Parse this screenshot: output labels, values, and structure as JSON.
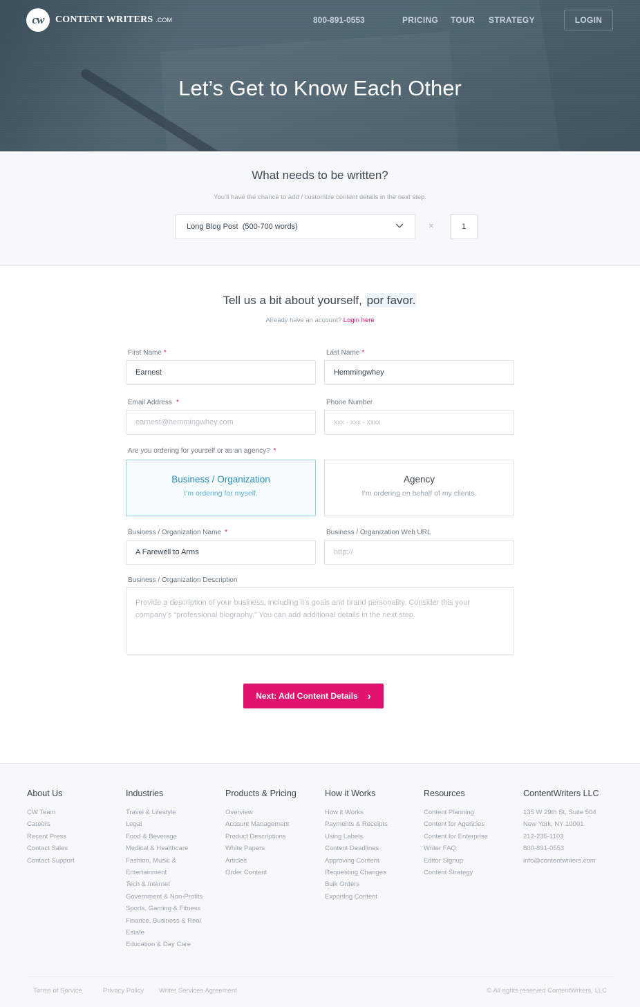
{
  "header": {
    "logo_mark": "cw",
    "logo_text": "CONTENT WRITERS",
    "logo_suffix": ".COM",
    "phone": "800-891-0553",
    "nav": [
      "PRICING",
      "TOUR",
      "STRATEGY"
    ],
    "login_label": "LOGIN",
    "hero_title": "Let’s Get to Know Each Other"
  },
  "content_select": {
    "title": "What needs to be written?",
    "hint": "You’ll have the chance to add / customize content details in the next step.",
    "selected_type": "Long Blog Post  (500-700 words)",
    "multiply_symbol": "×",
    "quantity": "1"
  },
  "about_form": {
    "title_main": "Tell us a bit about yourself,",
    "title_highlight": "por favor.",
    "account_prompt": "Already have an account?",
    "login_link": "Login here",
    "required_mark": "*",
    "first_name": {
      "label": "First Name",
      "value": "Earnest"
    },
    "last_name": {
      "label": "Last Name",
      "value": "Hemmingwhey"
    },
    "email": {
      "label": "Email Address",
      "placeholder": "earnest@hemmingwhey.com"
    },
    "phone": {
      "label": "Phone Number",
      "placeholder": "xxx - xxx - xxxx"
    },
    "ordering_question": "Are you ordering for yourself or as an agency?",
    "options": [
      {
        "title": "Business / Organization",
        "subtitle": "I’m ordering for myself.",
        "selected": true
      },
      {
        "title": "Agency",
        "subtitle": "I’m ordering on behalf of my clients.",
        "selected": false
      }
    ],
    "org_name": {
      "label": "Business / Organization Name",
      "value": "A Farewell to Arms"
    },
    "org_url": {
      "label": "Business / Organization Web URL",
      "placeholder": "http://"
    },
    "org_description": {
      "label": "Business / Organization Description",
      "placeholder": "Provide a description of your business, including it’s goals and brand personality. Consider this your company’s “professional biography.” You can add additional details in the next step."
    },
    "next_button": "Next: Add Content Details",
    "next_arrow": "›"
  },
  "footer": {
    "columns": [
      {
        "title": "About Us",
        "items": [
          "CW Team",
          "Careers",
          "Recent Press",
          "Contact Sales",
          "Contact Support"
        ]
      },
      {
        "title": "Industries",
        "items": [
          "Travel & Lifestyle",
          "Legal",
          "Food & Beverage",
          "Medical & Healthcare",
          "Fashion, Music & Entertainment",
          "Tech & Internet",
          "Government & Non-Profits",
          "Sports, Gaming & Fitness",
          "Finance, Business & Real Estate",
          "Education & Day Care"
        ]
      },
      {
        "title": "Products & Pricing",
        "items": [
          "Overview",
          "Account Management",
          "Product Descriptions",
          "White Papers",
          "Articles",
          "Order Content"
        ]
      },
      {
        "title": "How it Works",
        "items": [
          "How it Works",
          "Payments & Receipts",
          "Using Labels",
          "Content Deadlines",
          "Approving Content",
          "Requesting Changes",
          "Bulk Orders",
          "Exporting Content"
        ]
      },
      {
        "title": "Resources",
        "items": [
          "Content Planning",
          "Content for Agencies",
          "Content for Enterprise",
          "Writer FAQ",
          "Editor Signup",
          "Content Strategy"
        ]
      },
      {
        "title": "ContentWriters LLC",
        "items": [
          "135 W 29th St, Suite 504",
          "New York, NY 10001",
          "212-235-1103",
          "800-891-0553",
          "info@contentwriters.com"
        ]
      }
    ],
    "legal_links": [
      "Terms of Service",
      "Privacy Policy",
      "Writer Services Agreement"
    ],
    "copyright": "© All rights reserved ContentWriters, LLC"
  }
}
